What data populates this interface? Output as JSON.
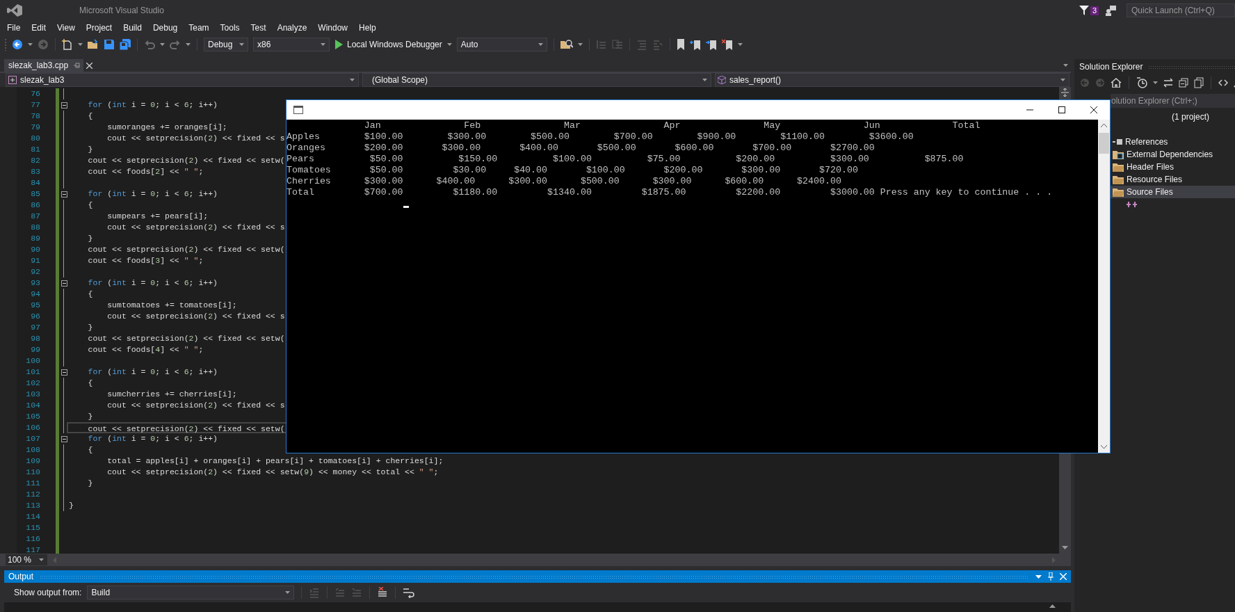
{
  "window": {
    "title": "Microsoft Visual Studio",
    "notifications": "3",
    "quick_launch": {
      "placeholder": "Quick Launch (Ctrl+Q)"
    }
  },
  "menu": [
    "File",
    "Edit",
    "View",
    "Project",
    "Build",
    "Debug",
    "Team",
    "Tools",
    "Test",
    "Analyze",
    "Window",
    "Help"
  ],
  "toolbar": {
    "configuration": "Debug",
    "platform": "x86",
    "debugger": "Local Windows Debugger",
    "target": "Auto"
  },
  "document_tabs": [
    {
      "label": "slezak_lab3.cpp",
      "selected": true
    }
  ],
  "navigation_bar": {
    "project": "slezak_lab3",
    "scope": "(Global Scope)",
    "member": "sales_report()"
  },
  "editor": {
    "zoom": "100 %",
    "lines": [
      {
        "number": "76",
        "foldable": false,
        "current": false
      },
      {
        "number": "77",
        "foldable": true,
        "current": false,
        "tokens": [
          {
            "kind": "keyword",
            "text": "    for"
          },
          {
            "kind": "plain",
            "text": " ("
          },
          {
            "kind": "keyword",
            "text": "int"
          },
          {
            "kind": "plain",
            "text": " i = "
          },
          {
            "kind": "number",
            "text": "0"
          },
          {
            "kind": "plain",
            "text": "; i < "
          },
          {
            "kind": "number",
            "text": "6"
          },
          {
            "kind": "plain",
            "text": "; i++)"
          }
        ]
      },
      {
        "number": "78",
        "foldable": false,
        "current": false,
        "tokens": [
          {
            "kind": "plain",
            "text": "    {"
          }
        ]
      },
      {
        "number": "79",
        "foldable": false,
        "current": false,
        "tokens": [
          {
            "kind": "plain",
            "text": "        sumoranges += oranges[i];"
          }
        ]
      },
      {
        "number": "80",
        "foldable": false,
        "current": false,
        "tokens": [
          {
            "kind": "plain",
            "text": "        cout << setprecision("
          },
          {
            "kind": "number",
            "text": "2"
          },
          {
            "kind": "plain",
            "text": ") << fixed << s"
          }
        ]
      },
      {
        "number": "81",
        "foldable": false,
        "current": false,
        "tokens": [
          {
            "kind": "plain",
            "text": "    }"
          }
        ]
      },
      {
        "number": "82",
        "foldable": false,
        "current": false,
        "tokens": [
          {
            "kind": "plain",
            "text": "    cout << setprecision("
          },
          {
            "kind": "number",
            "text": "2"
          },
          {
            "kind": "plain",
            "text": ") << fixed << setw("
          }
        ]
      },
      {
        "number": "83",
        "foldable": false,
        "current": false,
        "tokens": [
          {
            "kind": "plain",
            "text": "    cout << foods["
          },
          {
            "kind": "number",
            "text": "2"
          },
          {
            "kind": "plain",
            "text": "] << "
          },
          {
            "kind": "string",
            "text": "\" \""
          },
          {
            "kind": "plain",
            "text": ";"
          }
        ]
      },
      {
        "number": "84",
        "foldable": false,
        "current": false
      },
      {
        "number": "85",
        "foldable": true,
        "current": false,
        "tokens": [
          {
            "kind": "keyword",
            "text": "    for"
          },
          {
            "kind": "plain",
            "text": " ("
          },
          {
            "kind": "keyword",
            "text": "int"
          },
          {
            "kind": "plain",
            "text": " i = "
          },
          {
            "kind": "number",
            "text": "0"
          },
          {
            "kind": "plain",
            "text": "; i < "
          },
          {
            "kind": "number",
            "text": "6"
          },
          {
            "kind": "plain",
            "text": "; i++)"
          }
        ]
      },
      {
        "number": "86",
        "foldable": false,
        "current": false,
        "tokens": [
          {
            "kind": "plain",
            "text": "    {"
          }
        ]
      },
      {
        "number": "87",
        "foldable": false,
        "current": false,
        "tokens": [
          {
            "kind": "plain",
            "text": "        sumpears += pears[i];"
          }
        ]
      },
      {
        "number": "88",
        "foldable": false,
        "current": false,
        "tokens": [
          {
            "kind": "plain",
            "text": "        cout << setprecision("
          },
          {
            "kind": "number",
            "text": "2"
          },
          {
            "kind": "plain",
            "text": ") << fixed << s"
          }
        ]
      },
      {
        "number": "89",
        "foldable": false,
        "current": false,
        "tokens": [
          {
            "kind": "plain",
            "text": "    }"
          }
        ]
      },
      {
        "number": "90",
        "foldable": false,
        "current": false,
        "tokens": [
          {
            "kind": "plain",
            "text": "    cout << setprecision("
          },
          {
            "kind": "number",
            "text": "2"
          },
          {
            "kind": "plain",
            "text": ") << fixed << setw("
          }
        ]
      },
      {
        "number": "91",
        "foldable": false,
        "current": false,
        "tokens": [
          {
            "kind": "plain",
            "text": "    cout << foods["
          },
          {
            "kind": "number",
            "text": "3"
          },
          {
            "kind": "plain",
            "text": "] << "
          },
          {
            "kind": "string",
            "text": "\" \""
          },
          {
            "kind": "plain",
            "text": ";"
          }
        ]
      },
      {
        "number": "92",
        "foldable": false,
        "current": false
      },
      {
        "number": "93",
        "foldable": true,
        "current": false,
        "tokens": [
          {
            "kind": "keyword",
            "text": "    for"
          },
          {
            "kind": "plain",
            "text": " ("
          },
          {
            "kind": "keyword",
            "text": "int"
          },
          {
            "kind": "plain",
            "text": " i = "
          },
          {
            "kind": "number",
            "text": "0"
          },
          {
            "kind": "plain",
            "text": "; i < "
          },
          {
            "kind": "number",
            "text": "6"
          },
          {
            "kind": "plain",
            "text": "; i++)"
          }
        ]
      },
      {
        "number": "94",
        "foldable": false,
        "current": false,
        "tokens": [
          {
            "kind": "plain",
            "text": "    {"
          }
        ]
      },
      {
        "number": "95",
        "foldable": false,
        "current": false,
        "tokens": [
          {
            "kind": "plain",
            "text": "        sumtomatoes += tomatoes[i];"
          }
        ]
      },
      {
        "number": "96",
        "foldable": false,
        "current": false,
        "tokens": [
          {
            "kind": "plain",
            "text": "        cout << setprecision("
          },
          {
            "kind": "number",
            "text": "2"
          },
          {
            "kind": "plain",
            "text": ") << fixed << s"
          }
        ]
      },
      {
        "number": "97",
        "foldable": false,
        "current": false,
        "tokens": [
          {
            "kind": "plain",
            "text": "    }"
          }
        ]
      },
      {
        "number": "98",
        "foldable": false,
        "current": false,
        "tokens": [
          {
            "kind": "plain",
            "text": "    cout << setprecision("
          },
          {
            "kind": "number",
            "text": "2"
          },
          {
            "kind": "plain",
            "text": ") << fixed << setw("
          }
        ]
      },
      {
        "number": "99",
        "foldable": false,
        "current": false,
        "tokens": [
          {
            "kind": "plain",
            "text": "    cout << foods["
          },
          {
            "kind": "number",
            "text": "4"
          },
          {
            "kind": "plain",
            "text": "] << "
          },
          {
            "kind": "string",
            "text": "\" \""
          },
          {
            "kind": "plain",
            "text": ";"
          }
        ]
      },
      {
        "number": "100",
        "foldable": false,
        "current": false
      },
      {
        "number": "101",
        "foldable": true,
        "current": false,
        "tokens": [
          {
            "kind": "keyword",
            "text": "    for"
          },
          {
            "kind": "plain",
            "text": " ("
          },
          {
            "kind": "keyword",
            "text": "int"
          },
          {
            "kind": "plain",
            "text": " i = "
          },
          {
            "kind": "number",
            "text": "0"
          },
          {
            "kind": "plain",
            "text": "; i < "
          },
          {
            "kind": "number",
            "text": "6"
          },
          {
            "kind": "plain",
            "text": "; i++)"
          }
        ]
      },
      {
        "number": "102",
        "foldable": false,
        "current": false,
        "tokens": [
          {
            "kind": "plain",
            "text": "    {"
          }
        ]
      },
      {
        "number": "103",
        "foldable": false,
        "current": false,
        "tokens": [
          {
            "kind": "plain",
            "text": "        sumcherries += cherries[i];"
          }
        ]
      },
      {
        "number": "104",
        "foldable": false,
        "current": false,
        "tokens": [
          {
            "kind": "plain",
            "text": "        cout << setprecision("
          },
          {
            "kind": "number",
            "text": "2"
          },
          {
            "kind": "plain",
            "text": ") << fixed << s"
          }
        ]
      },
      {
        "number": "105",
        "foldable": false,
        "current": false,
        "tokens": [
          {
            "kind": "plain",
            "text": "    }"
          }
        ]
      },
      {
        "number": "106",
        "foldable": false,
        "current": true,
        "tokens": [
          {
            "kind": "plain",
            "text": "    cout << setprecision("
          },
          {
            "kind": "number",
            "text": "2"
          },
          {
            "kind": "plain",
            "text": ") << fixed << setw("
          }
        ]
      },
      {
        "number": "107",
        "foldable": true,
        "current": false,
        "tokens": [
          {
            "kind": "keyword",
            "text": "    for"
          },
          {
            "kind": "plain",
            "text": " ("
          },
          {
            "kind": "keyword",
            "text": "int"
          },
          {
            "kind": "plain",
            "text": " i = "
          },
          {
            "kind": "number",
            "text": "0"
          },
          {
            "kind": "plain",
            "text": "; i < "
          },
          {
            "kind": "number",
            "text": "6"
          },
          {
            "kind": "plain",
            "text": "; i++)"
          }
        ]
      },
      {
        "number": "108",
        "foldable": false,
        "current": false,
        "tokens": [
          {
            "kind": "plain",
            "text": "    {"
          }
        ]
      },
      {
        "number": "109",
        "foldable": false,
        "current": false,
        "tokens": [
          {
            "kind": "plain",
            "text": "        total = apples[i] + oranges[i] + pears[i] + tomatoes[i] + cherries[i];"
          }
        ]
      },
      {
        "number": "110",
        "foldable": false,
        "current": false,
        "tokens": [
          {
            "kind": "plain",
            "text": "        cout << setprecision("
          },
          {
            "kind": "number",
            "text": "2"
          },
          {
            "kind": "plain",
            "text": ") << fixed << setw("
          },
          {
            "kind": "number",
            "text": "9"
          },
          {
            "kind": "plain",
            "text": ") << money << total << "
          },
          {
            "kind": "string",
            "text": "\" \""
          },
          {
            "kind": "plain",
            "text": ";"
          }
        ]
      },
      {
        "number": "111",
        "foldable": false,
        "current": false,
        "tokens": [
          {
            "kind": "plain",
            "text": "    }"
          }
        ]
      },
      {
        "number": "112",
        "foldable": false,
        "current": false
      },
      {
        "number": "113",
        "foldable": false,
        "current": false,
        "tokens": [
          {
            "kind": "plain",
            "text": "}"
          }
        ]
      },
      {
        "number": "114",
        "foldable": false,
        "current": false
      },
      {
        "number": "115",
        "foldable": false,
        "current": false
      },
      {
        "number": "116",
        "foldable": false,
        "current": false
      },
      {
        "number": "117",
        "foldable": false,
        "current": false
      }
    ]
  },
  "console": {
    "lines": [
      "              Jan               Feb               Mar               Apr               May               Jun             Total",
      "Apples        $100.00        $300.00        $500.00        $700.00        $900.00        $1100.00        $3600.00",
      "Oranges       $200.00       $300.00       $400.00       $500.00       $600.00       $700.00       $2700.00",
      "Pears          $50.00          $150.00          $100.00          $75.00          $200.00          $300.00          $875.00",
      "Tomatoes       $50.00         $30.00     $40.00       $100.00       $200.00       $300.00       $720.00",
      "Cherries      $300.00      $400.00      $300.00      $500.00      $300.00      $600.00      $2400.00",
      "Total         $700.00         $1180.00         $1340.00         $1875.00         $2200.00         $3000.00 Press any key to continue . . ."
    ]
  },
  "solution_explorer": {
    "title": "Solution Explorer",
    "search": {
      "placeholder": "olution Explorer (Ctrl+;)"
    },
    "items": [
      {
        "kind": "solution",
        "label": "(1 project)",
        "selected": false,
        "children": [
          {
            "children": [
              {
                "kind": "references",
                "label": "References",
                "selected": false
              },
              {
                "kind": "dependencies",
                "label": "External Dependencies",
                "selected": false
              },
              {
                "kind": "folder",
                "label": "Header Files",
                "selected": false
              },
              {
                "kind": "folder",
                "label": "Resource Files",
                "selected": false
              },
              {
                "kind": "folder",
                "label": "Source Files",
                "selected": true,
                "children": [
                  {
                    "kind": "cpp-file",
                    "selected": false
                  }
                ]
              }
            ]
          }
        ]
      }
    ]
  },
  "output": {
    "title": "Output",
    "source_label": "Show output from:",
    "source": "Build"
  }
}
